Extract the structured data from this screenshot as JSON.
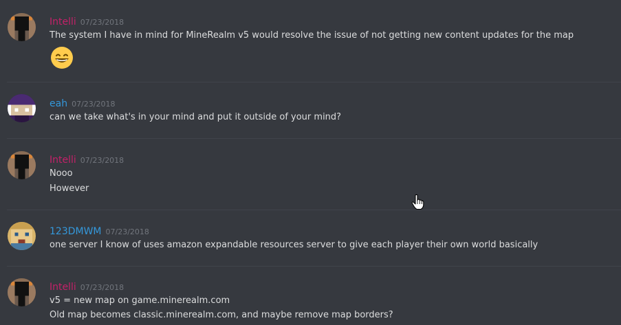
{
  "colors": {
    "background": "#36393f",
    "divider": "#40444b",
    "username_intelli": "#c42169",
    "username_blue": "#3498db",
    "timestamp": "#72767d",
    "text": "#dcddde"
  },
  "messages": [
    {
      "user": "Intelli",
      "time": "07/23/2018",
      "avatar": "intelli-avatar",
      "lines": [
        "The system I have in mind for MineRealm v5 would resolve the issue of not getting new content updates for the map"
      ],
      "emoji": "grinning-face-icon"
    },
    {
      "user": "eah",
      "time": "07/23/2018",
      "avatar": "eah-avatar",
      "lines": [
        "can we take what's in your mind and put it outside of your mind?"
      ]
    },
    {
      "user": "Intelli",
      "time": "07/23/2018",
      "avatar": "intelli-avatar",
      "lines": [
        "Nooo",
        "However"
      ]
    },
    {
      "user": "123DMWM",
      "time": "07/23/2018",
      "avatar": "123dmwm-avatar",
      "lines": [
        "one server I know of uses amazon expandable resources server to give each player their own world basically"
      ]
    },
    {
      "user": "Intelli",
      "time": "07/23/2018",
      "avatar": "intelli-avatar",
      "lines": [
        "v5 = new map on game.minerealm.com",
        "Old map becomes classic.minerealm.com, and maybe remove map borders?"
      ]
    }
  ]
}
